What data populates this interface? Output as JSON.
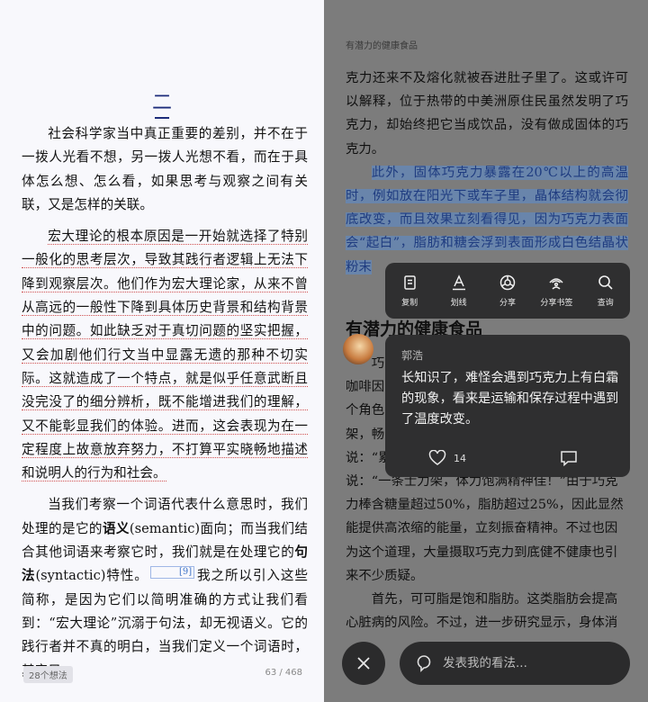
{
  "left_page": {
    "chapter_number": "二",
    "paragraphs": {
      "p1": "社会科学家当中真正重要的差别，并不在于一拨人光看不想，另一拨人光想不看，而在于具体怎么想、怎么看，如果思考与观察之间有关联，又是怎样的关联。",
      "p2": "宏大理论的根本原因是一开始就选择了特别一般化的思考层次，导致其践行者逻辑上无法下降到观察层次。他们作为宏大理论家，从来不曾从高远的一般性下降到具体历史背景和结构背景中的问题。如此缺乏对于真切问题的坚实把握，又会加剧他们行文当中显露无遗的那种不切实际。这就造成了一个特点，就是似乎任意武断且没完没了的细分辨析，既不能增进我们的理解，又不能彰显我们的体验。进而，这会表现为在一定程度上故意放弃努力，不打算平实晓畅地描述和说明人的行为和社会。",
      "p3a": "当我们考察一个词语代表什么意思时，我们处理的是它的",
      "p3b_bold": "语义",
      "p3c": "(semantic)面向；而当我们结合其他词语来考察它时，我们就是在处理它的",
      "p3d_bold": "句法",
      "p3e": "(syntactic)特性。",
      "footnote": "[9]",
      "p3f": "我之所以引入这些简称，是因为它们以简明准确的方式让我们看到：“宏大理论”沉溺于句法，却无视语义。它的践行者并不真的明白，当我们定义一个词语时，其实只"
    },
    "ideas_badge": "28个想法",
    "page_counter": "63 / 468"
  },
  "right_page": {
    "running_head": "有潜力的健康食品",
    "para1": "克力还来不及熔化就被吞进肚子里了。这或许可以解释，位于热带的中美洲原住民虽然发明了巧克力，却始终把它当成饮品，没有做成固体的巧克力。",
    "highlight": "此外，固体巧克力暴露在20℃以上的高温时，例如放在阳光下或车子里，晶体结构就会彻底改变，而且效果立刻看得见，因为巧克力表面会“起白”，脂肪和糖会浮到表面形成白色结晶状粉末",
    "section_heading": "有潜力的健康食品",
    "para2_lines": [
      "巧",
      "咖啡因",
      "个角色",
      "架，畅",
      "说：“累"
    ],
    "para3": "说：“一条士力架，体力饱满精神佳！”由于巧克力棒含糖量超过50%，脂肪超过25%，因此显然能提供高浓缩的能量，立刻振奋精神。不过也因为这个道理，大量摄取巧克力到底健不健康也引来不少质疑。",
    "para4": "首先，可可脂是饱和脂肪。这类脂肪会提高心脏病的风险。不过，进一步研究显示，身体消"
  },
  "toolbar": {
    "items": [
      {
        "label": "复制",
        "icon": "copy-icon"
      },
      {
        "label": "划线",
        "icon": "underline-icon"
      },
      {
        "label": "分享",
        "icon": "share-icon"
      },
      {
        "label": "分享书签",
        "icon": "share-bookmark-icon"
      },
      {
        "label": "查询",
        "icon": "search-icon"
      }
    ]
  },
  "comment": {
    "author": "郭浩",
    "text": "长知识了，难怪会遇到巧克力上有白霜的现象，看来是运输和保存过程中遇到了温度改变。",
    "likes": "14"
  },
  "bottom_bar": {
    "placeholder": "发表我的看法..."
  },
  "colors": {
    "highlight": "#5a8cd2",
    "overlay": "#7c7c7c",
    "card": "#2f2f30",
    "chapter_accent": "#1d2c7a"
  }
}
